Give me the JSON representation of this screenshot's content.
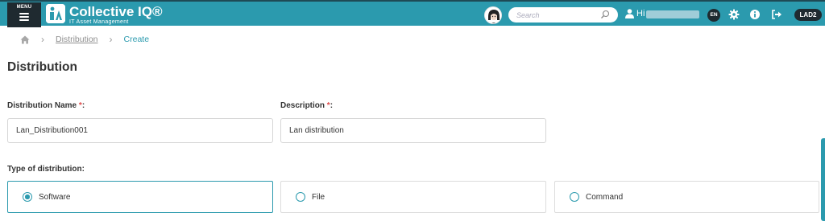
{
  "header": {
    "menu_label": "MENU",
    "brand_name": "Collective IQ®",
    "brand_tagline": "IT Asset Management",
    "search_placeholder": "Search",
    "greeting": "Hi",
    "language": "EN",
    "site_code": "LAD2",
    "icons": [
      "menu-icon",
      "avatar",
      "search-icon",
      "user-icon",
      "gear-icon",
      "info-icon",
      "logout-icon"
    ],
    "accent_color": "#2b9aae",
    "dark_color": "#1f2a30"
  },
  "breadcrumb": {
    "items": [
      "Distribution",
      "Create"
    ]
  },
  "page": {
    "title": "Distribution"
  },
  "form": {
    "name_label": "Distribution Name",
    "name_value": "Lan_Distribution001",
    "description_label": "Description",
    "description_value": "Lan distribution",
    "required_marker": "*",
    "colon": ":",
    "type_label": "Type of distribution:",
    "types": [
      {
        "label": "Software",
        "selected": true
      },
      {
        "label": "File",
        "selected": false
      },
      {
        "label": "Command",
        "selected": false
      }
    ]
  }
}
